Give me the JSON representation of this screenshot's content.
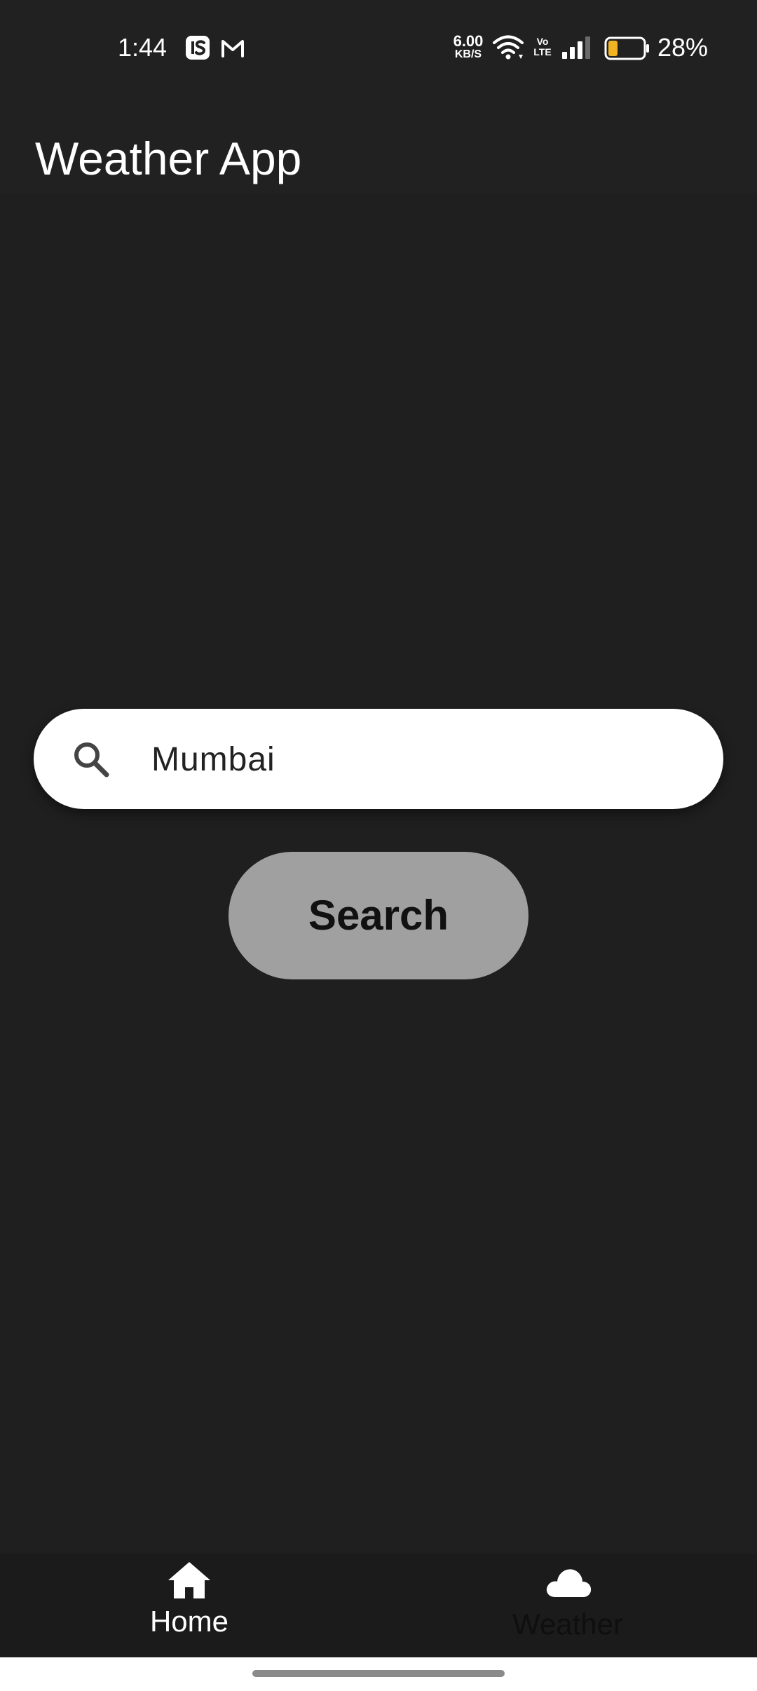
{
  "status_bar": {
    "time": "1:44",
    "net_speed_value": "6.00",
    "net_speed_unit": "KB/S",
    "volte_top": "Vo",
    "volte_bottom": "LTE",
    "battery_percent": "28%",
    "battery_level": 0.28,
    "battery_fill_color": "#f0b323",
    "notification_icons": [
      "is-app-icon",
      "gmail-icon"
    ]
  },
  "app_bar": {
    "title": "Weather App"
  },
  "search": {
    "value": "Mumbai",
    "button_label": "Search"
  },
  "bottom_nav": {
    "items": [
      {
        "label": "Home",
        "icon": "home-icon",
        "selected": true
      },
      {
        "label": "Weather",
        "icon": "cloud-icon",
        "selected": false
      }
    ]
  },
  "colors": {
    "background": "#1f1f1f",
    "app_bar": "#212121",
    "search_field": "#ffffff",
    "search_button": "#a0a0a0",
    "bottom_nav": "#1b1b1b"
  }
}
